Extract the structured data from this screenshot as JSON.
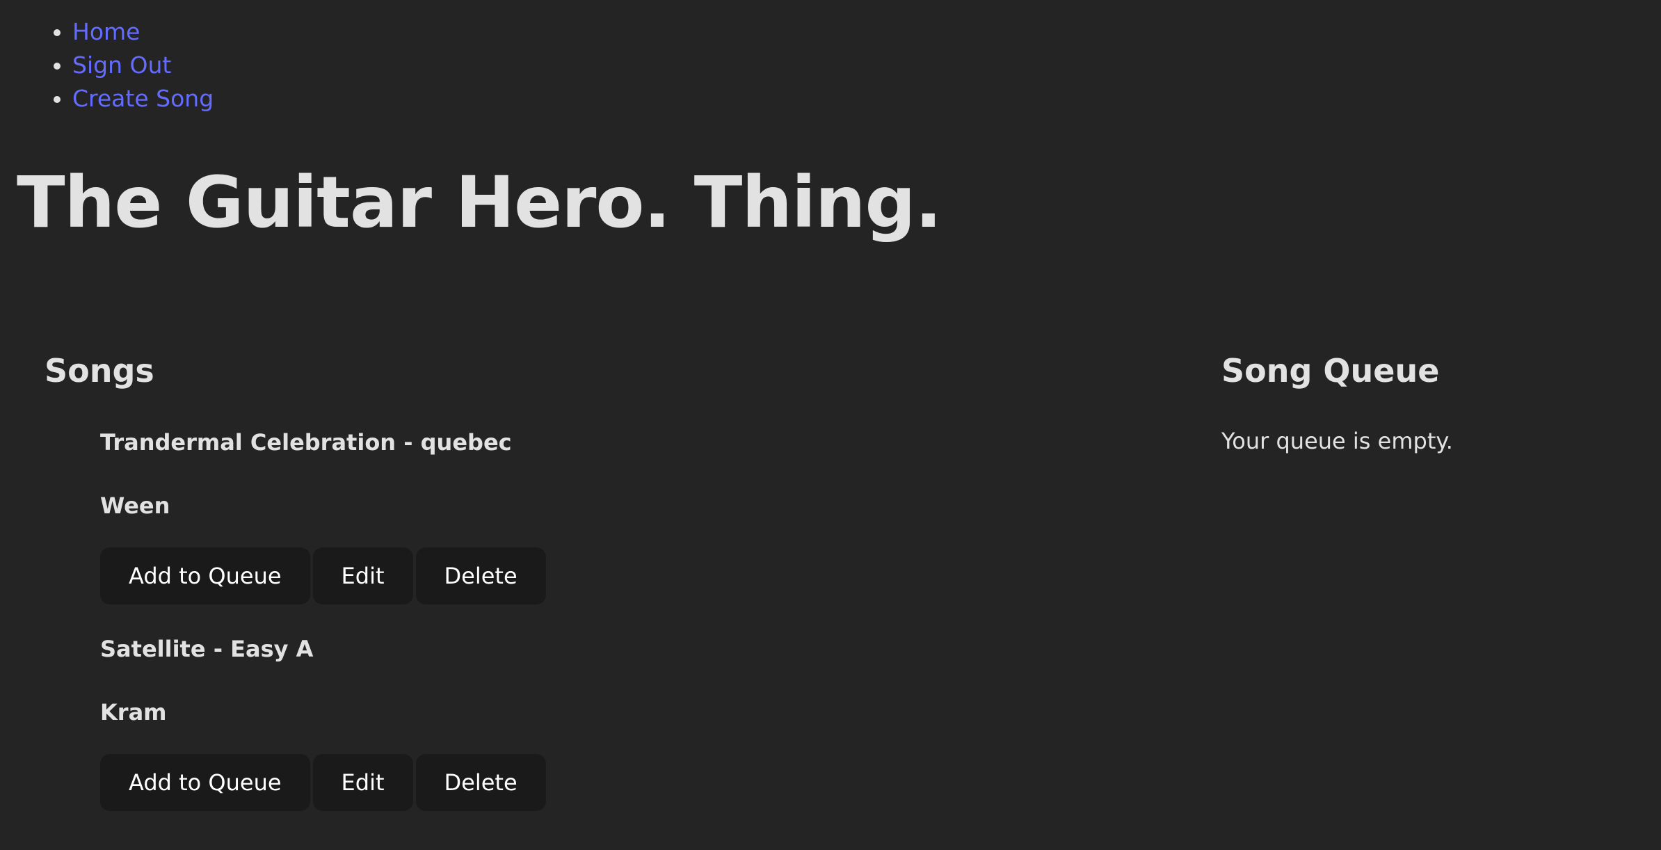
{
  "nav": {
    "items": [
      {
        "label": "Home"
      },
      {
        "label": "Sign Out"
      },
      {
        "label": "Create Song"
      }
    ]
  },
  "page": {
    "title": "The Guitar Hero. Thing."
  },
  "songs": {
    "heading": "Songs",
    "items": [
      {
        "title": "Trandermal Celebration - quebec",
        "artist": "Ween",
        "add_label": "Add to Queue",
        "edit_label": "Edit",
        "delete_label": "Delete"
      },
      {
        "title": "Satellite - Easy A",
        "artist": "Kram",
        "add_label": "Add to Queue",
        "edit_label": "Edit",
        "delete_label": "Delete"
      }
    ]
  },
  "queue": {
    "heading": "Song Queue",
    "empty_message": "Your queue is empty."
  },
  "colors": {
    "background": "#242424",
    "link": "#646cff",
    "button_bg": "#1a1a1a"
  }
}
